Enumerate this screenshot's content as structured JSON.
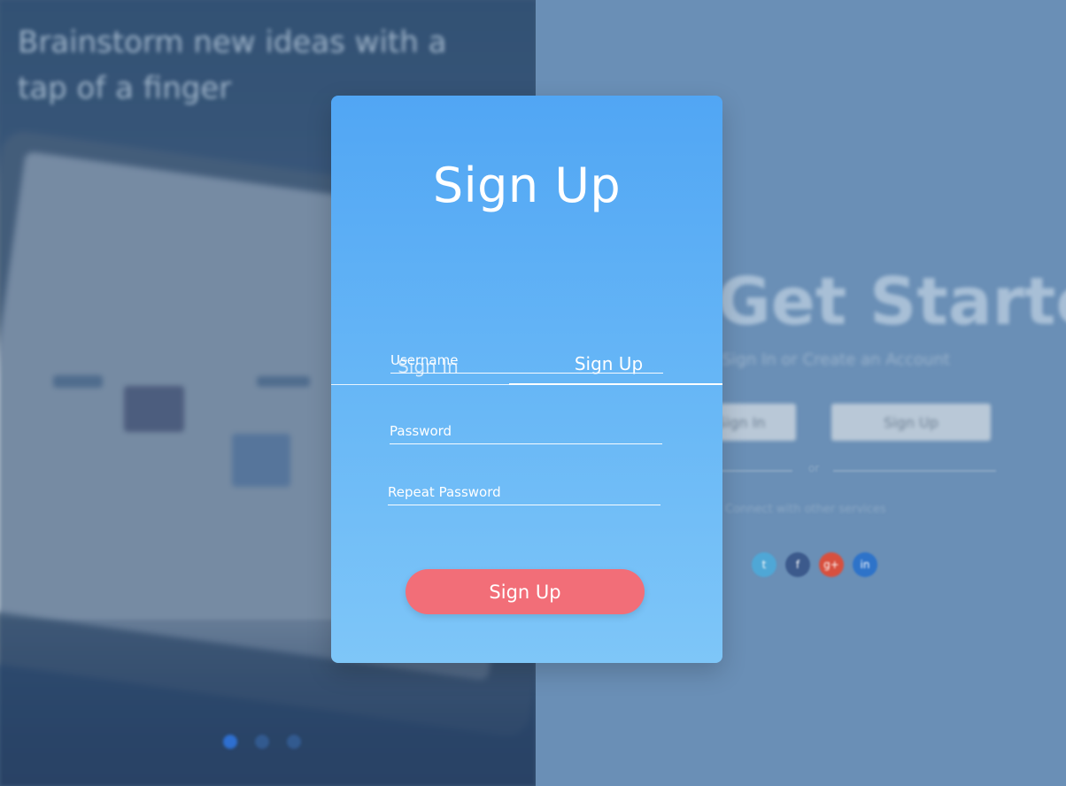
{
  "background": {
    "headline": "Brainstorm new ideas with a tap of a finger",
    "right_heading": "Get Started",
    "right_subtitle": "Sign In or Create an Account",
    "right_buttons": [
      "Sign In",
      "Sign Up"
    ],
    "or_text": "or",
    "connect_text": "Connect with other services",
    "social_icons": [
      "twitter-icon",
      "facebook-icon",
      "google-plus-icon",
      "linkedin-icon"
    ],
    "carousel_dots": 3
  },
  "modal": {
    "title": "Sign Up",
    "tabs": [
      {
        "label": "Sign In",
        "active": false
      },
      {
        "label": "Sign Up",
        "active": true
      }
    ],
    "fields": {
      "username": {
        "placeholder": "Username",
        "value": ""
      },
      "password": {
        "placeholder": "Password",
        "value": ""
      },
      "repeat_password": {
        "placeholder": "Repeat Password",
        "value": ""
      }
    },
    "submit_label": "Sign Up"
  },
  "colors": {
    "card_top": "#51a6f4",
    "card_bottom": "#7ec6f8",
    "submit_button": "#f26e78",
    "background_right": "#6a8fb6"
  }
}
